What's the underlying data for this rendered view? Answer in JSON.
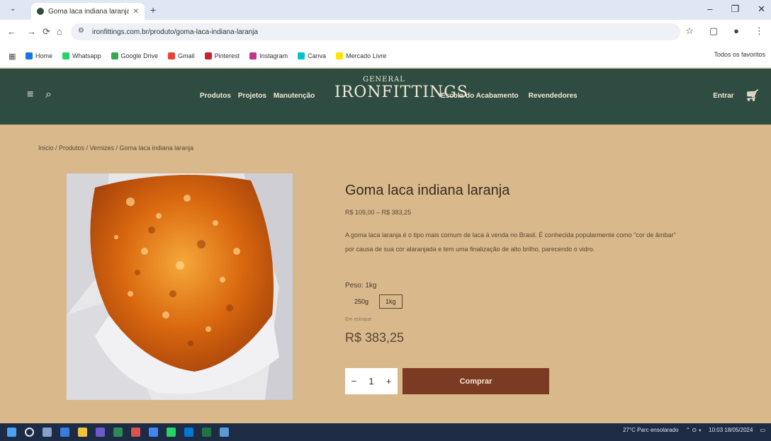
{
  "browser": {
    "tab_title": "Goma laca indiana laranja - Gen...",
    "url": "ironfittings.com.br/produto/goma-laca-indiana-laranja",
    "bookmarks": [
      "Home",
      "Whatsapp",
      "Google Drive",
      "Gmail",
      "Pinterest",
      "Instagram",
      "Canva",
      "Mercado Livre"
    ],
    "bookmarks_right": "Todos os favoritos"
  },
  "site": {
    "brand_top": "GENERAL",
    "brand_main": "IRONFITTINGS",
    "menu_left": [
      "Produtos",
      "Projetos",
      "Manutenção"
    ],
    "menu_right": [
      "Escola do Acabamento",
      "Revendedores"
    ],
    "account_label": "Entrar"
  },
  "product": {
    "breadcrumb": "Início / Produtos / Vernizes / Goma laca indiana laranja",
    "title": "Goma laca indiana laranja",
    "price_range": "R$ 109,00 – R$ 383,25",
    "description": "A goma laca laranja é o tipo mais comum de laca à venda no Brasil. É conhecida popularmente como \"cor de âmbar\" por causa de sua cor alaranjada e tem uma finalização de alto brilho, parecendo o vidro.",
    "weight_label": "Peso: 1kg",
    "options": [
      "250g",
      "1kg"
    ],
    "selected_option": "1kg",
    "stock": "Em estoque",
    "price": "R$ 383,25",
    "quantity": "1",
    "buy_label": "Comprar"
  },
  "taskbar": {
    "weather": "27°C Parc ensolarado",
    "time": "10:03",
    "date": "18/05/2024"
  },
  "colors": {
    "header": "#2e4c41",
    "page_bg": "#d9b98c",
    "buy_button": "#7b3a22"
  }
}
